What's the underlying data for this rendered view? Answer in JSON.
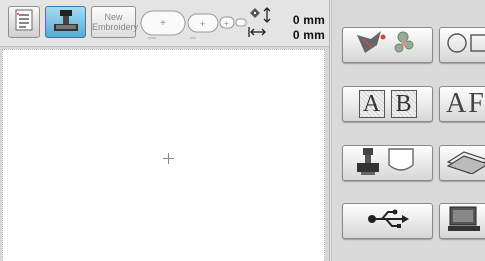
{
  "toolbar": {
    "list_icon": "list-icon",
    "machine_icon": "sewing-machine-icon",
    "new_embroidery_line1": "New",
    "new_embroidery_line2": "Embroidery",
    "frame_icon": "embroidery-frames-icon",
    "offset_icon": "offset-arrows-icon",
    "readout_vertical": "0 mm",
    "readout_horizontal": "0 mm"
  },
  "panel": {
    "buttons": [
      {
        "icon": "floral-pattern-icon"
      },
      {
        "icon": "frame-shapes-icon"
      },
      {
        "icon": "alphabet-characters-icon",
        "label_a": "A",
        "label_b": "B"
      },
      {
        "icon": "decorative-alphabet-icon",
        "label": "AF"
      },
      {
        "icon": "machine-pocket-icon"
      },
      {
        "icon": "pattern-cards-icon"
      },
      {
        "icon": "usb-icon"
      },
      {
        "icon": "computer-icon"
      }
    ]
  },
  "colors": {
    "accent_blue": "#5aa9d2",
    "canvas_bg": "#ffffff",
    "panel_bg": "#dadada"
  }
}
